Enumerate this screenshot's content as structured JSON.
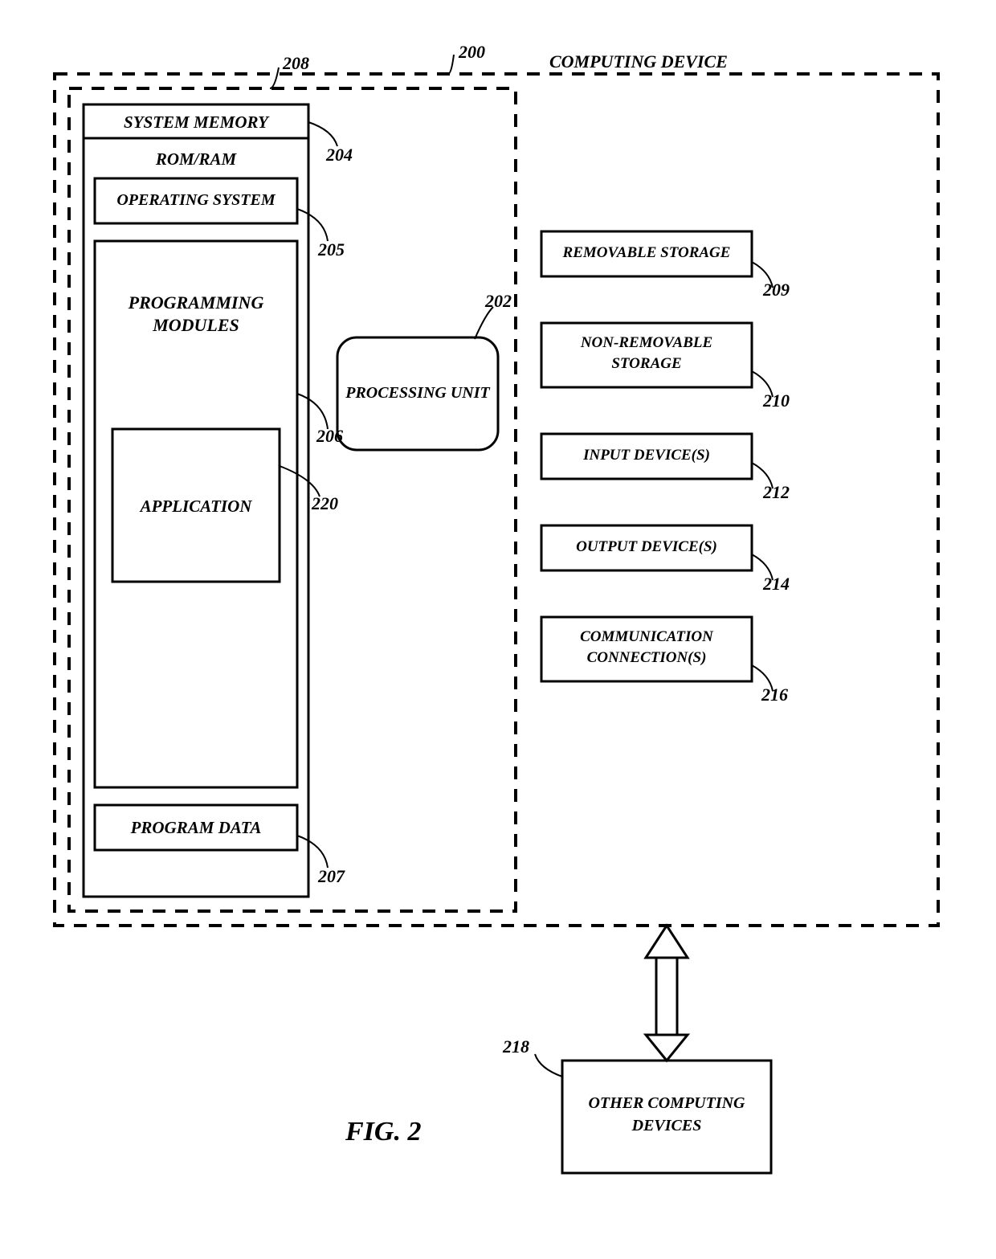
{
  "title_outer": "COMPUTING DEVICE",
  "ref_outer": "200",
  "ref_inner": "208",
  "memory": {
    "title": "SYSTEM MEMORY",
    "ref": "204",
    "subtitle": "ROM/RAM",
    "os": {
      "label": "OPERATING SYSTEM",
      "ref": "205"
    },
    "modules": {
      "label_line1": "PROGRAMMING",
      "label_line2": "MODULES",
      "ref": "206"
    },
    "app": {
      "label": "APPLICATION",
      "ref": "220"
    },
    "program_data": {
      "label": "PROGRAM DATA",
      "ref": "207"
    }
  },
  "cpu": {
    "label": "PROCESSING UNIT",
    "ref": "202"
  },
  "side": {
    "removable": {
      "label": "REMOVABLE STORAGE",
      "ref": "209"
    },
    "nonremovable": {
      "label_line1": "NON-REMOVABLE",
      "label_line2": "STORAGE",
      "ref": "210"
    },
    "input": {
      "label": "INPUT DEVICE(S)",
      "ref": "212"
    },
    "output": {
      "label": "OUTPUT DEVICE(S)",
      "ref": "214"
    },
    "comm": {
      "label_line1": "COMMUNICATION",
      "label_line2": "CONNECTION(S)",
      "ref": "216"
    }
  },
  "other": {
    "label_line1": "OTHER COMPUTING",
    "label_line2": "DEVICES",
    "ref": "218"
  },
  "caption": "FIG. 2"
}
